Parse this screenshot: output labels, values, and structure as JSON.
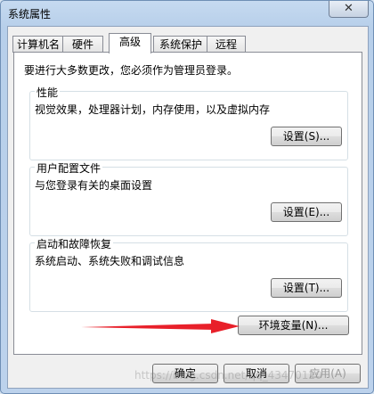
{
  "window": {
    "title": "系统属性",
    "close_glyph": "✕"
  },
  "tabs": [
    {
      "label": "计算机名"
    },
    {
      "label": "硬件"
    },
    {
      "label": "高级",
      "active": true
    },
    {
      "label": "系统保护"
    },
    {
      "label": "远程"
    }
  ],
  "intro_text": "要进行大多数更改，您必须作为管理员登录。",
  "groups": [
    {
      "title": "性能",
      "description": "视觉效果，处理器计划，内存使用，以及虚拟内存",
      "button": "设置(S)..."
    },
    {
      "title": "用户配置文件",
      "description": "与您登录有关的桌面设置",
      "button": "设置(E)..."
    },
    {
      "title": "启动和故障恢复",
      "description": "系统启动、系统失败和调试信息",
      "button": "设置(T)..."
    }
  ],
  "env_button": "环境变量(N)...",
  "footer": {
    "ok": "确定",
    "cancel": "取消",
    "apply": "应用(A)"
  },
  "watermark": "https://blog.csdn.net/qq_43470120",
  "colors": {
    "arrow": "#e8202a",
    "panel_border": "#898c95",
    "title_gradient": "#b7cfea"
  }
}
